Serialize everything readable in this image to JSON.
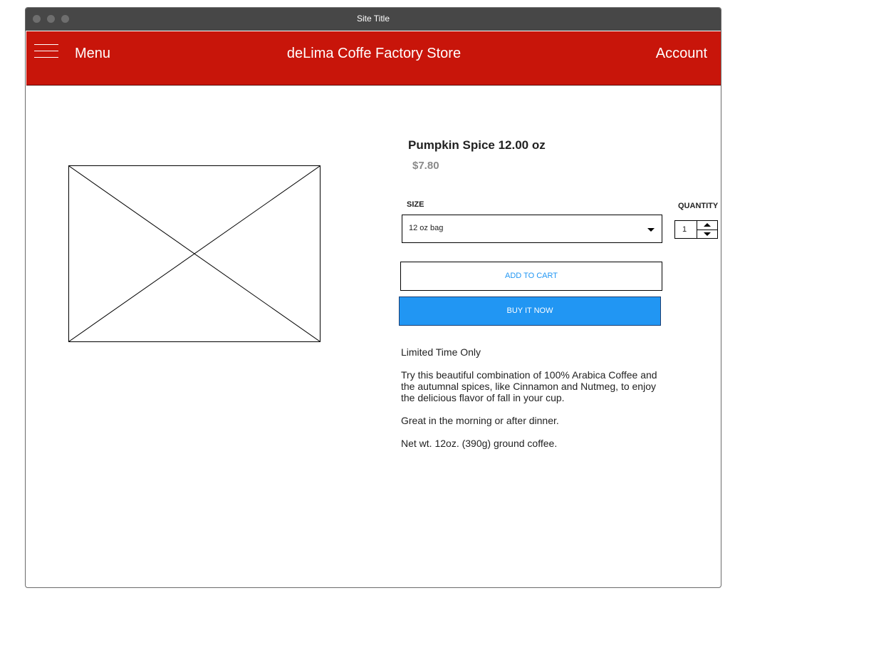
{
  "window": {
    "title": "Site Title"
  },
  "navbar": {
    "menu_label": "Menu",
    "store_title": "deLima Coffe Factory Store",
    "account_label": "Account",
    "color": "#c8150a"
  },
  "product": {
    "name": "Pumpkin Spice 12.00 oz",
    "price": "$7.80",
    "size_label": "SIZE",
    "size_selected": "12 oz bag",
    "quantity_label": "QUANTITY",
    "quantity_value": "1",
    "add_to_cart_label": "ADD TO CART",
    "buy_now_label": "BUY IT NOW",
    "accent_color": "#2196f3",
    "description": [
      "Limited Time Only",
      "Try this beautiful combination of 100% Arabica Coffee and the autumnal spices, like Cinnamon and Nutmeg, to enjoy the delicious flavor of fall in your cup.",
      "Great in the morning or after dinner.",
      "Net wt. 12oz. (390g) ground coffee."
    ]
  },
  "icons": {
    "menu": "hamburger-icon",
    "dropdown": "chevron-down-icon",
    "increment": "chevron-up-icon",
    "decrement": "chevron-down-icon",
    "image": "image-placeholder-icon"
  }
}
